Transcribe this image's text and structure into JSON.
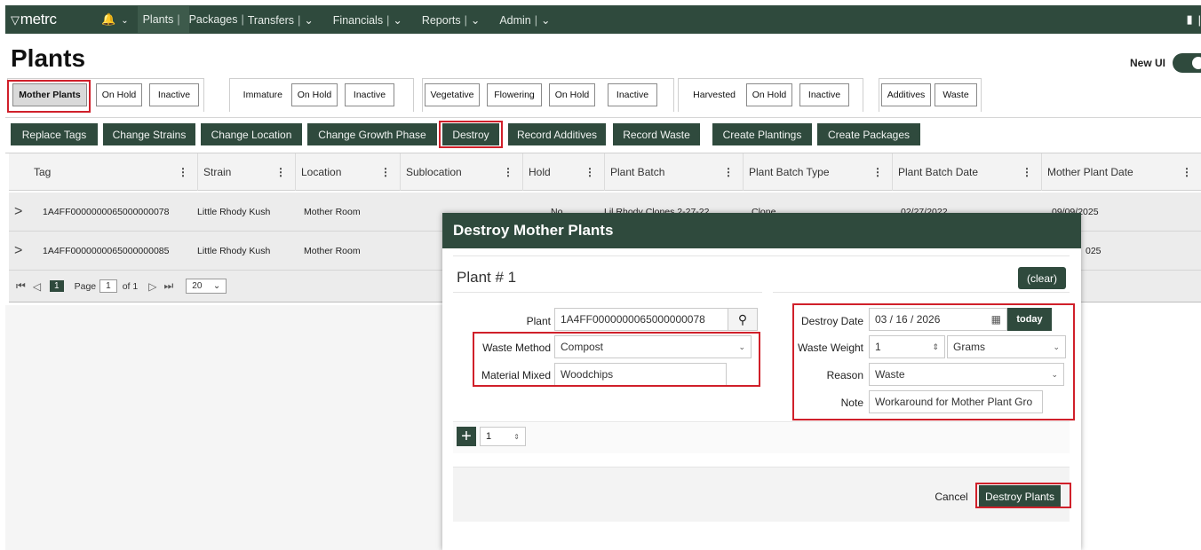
{
  "topbar": {
    "logo": "metrc",
    "nav": [
      {
        "label": "Plants",
        "sep": "|"
      },
      {
        "label": "Packages",
        "sep": "|"
      },
      {
        "label": "Transfers",
        "sep": "|"
      },
      {
        "label": "Financials",
        "sep": "|"
      },
      {
        "label": "Reports",
        "sep": "|"
      },
      {
        "label": "Admin",
        "sep": "|"
      }
    ]
  },
  "page": {
    "title": "Plants",
    "new_ui_label": "New UI"
  },
  "tabs": [
    "Mother Plants",
    "On Hold",
    "Inactive",
    "Immature",
    "On Hold",
    "Inactive",
    "Vegetative",
    "Flowering",
    "On Hold",
    "Inactive",
    "Harvested",
    "On Hold",
    "Inactive",
    "Additives",
    "Waste"
  ],
  "actions": [
    "Replace Tags",
    "Change Strains",
    "Change Location",
    "Change Growth Phase",
    "Destroy",
    "Record Additives",
    "Record Waste",
    "Create Plantings",
    "Create Packages"
  ],
  "grid": {
    "columns": [
      "Tag",
      "Strain",
      "Location",
      "Sublocation",
      "Hold",
      "Plant Batch",
      "Plant Batch Type",
      "Plant Batch Date",
      "Mother Plant Date"
    ],
    "rows": [
      {
        "tag": "1A4FF0000000065000000078",
        "strain": "Little Rhody Kush",
        "location": "Mother Room",
        "hold": "No",
        "batch": "Lil Rhody Clones 2-27-22",
        "type": "Clone",
        "batch_date": "02/27/2022",
        "mother_date": "09/09/2025"
      },
      {
        "tag": "1A4FF0000000065000000085",
        "strain": "Little Rhody Kush",
        "location": "Mother Room",
        "hold": "",
        "batch": "",
        "type": "",
        "batch_date": "",
        "mother_date": "025"
      }
    ],
    "pager": {
      "current": "1",
      "page_label": "Page",
      "page_value": "1",
      "of_label": "of 1",
      "page_size": "20"
    }
  },
  "modal": {
    "title": "Destroy Mother Plants",
    "plant_number": "Plant # 1",
    "clear_label": "(clear)",
    "plant_label": "Plant",
    "plant_value": "1A4FF0000000065000000078",
    "waste_method_label": "Waste Method",
    "waste_method_value": "Compost",
    "material_mixed_label": "Material Mixed",
    "material_mixed_value": "Woodchips",
    "destroy_date_label": "Destroy Date",
    "destroy_date_value": "03 / 16 / 2026",
    "today_label": "today",
    "waste_weight_label": "Waste Weight",
    "waste_weight_value": "1",
    "weight_unit": "Grams",
    "reason_label": "Reason",
    "reason_value": "Waste",
    "note_label": "Note",
    "note_value": "Workaround for Mother Plant Gro",
    "add_count": "1",
    "cancel_label": "Cancel",
    "submit_label": "Destroy Plants"
  },
  "colors": {
    "primary": "#2f4a3d",
    "highlight": "#d0202a"
  }
}
